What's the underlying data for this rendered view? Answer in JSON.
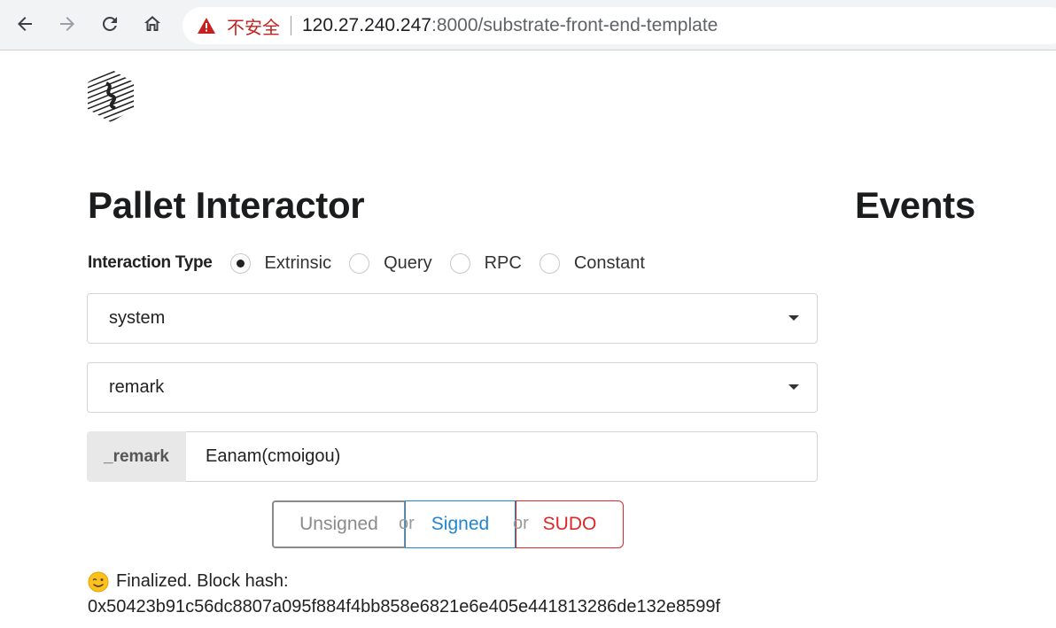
{
  "browser": {
    "security_label": "不安全",
    "url_host": "120.27.240.247",
    "url_path": ":8000/substrate-front-end-template"
  },
  "page": {
    "title": "Pallet Interactor",
    "events_title": "Events"
  },
  "interaction": {
    "label": "Interaction Type",
    "options": [
      "Extrinsic",
      "Query",
      "RPC",
      "Constant"
    ],
    "selected": "Extrinsic"
  },
  "pallet_select": {
    "value": "system"
  },
  "callable_select": {
    "value": "remark"
  },
  "param": {
    "label": "_remark",
    "value": "Eanam(cmoigou)"
  },
  "buttons": {
    "unsigned": "Unsigned",
    "or1": "or",
    "signed": "Signed",
    "or2": "or",
    "sudo": "SUDO"
  },
  "status": {
    "text": "Finalized. Block hash:",
    "hash": "0x50423b91c56dc8807a095f884f4bb858e6821e6e405e441813286de132e8599f"
  },
  "icons": {
    "back": "arrow-left-icon",
    "forward": "arrow-right-icon",
    "reload": "reload-icon",
    "home": "home-icon",
    "warning": "warning-triangle-icon",
    "logo": "substrate-logo",
    "status_emoji": "wink-emoji-icon"
  },
  "colors": {
    "signed": "#2185d0",
    "sudo": "#db2828",
    "unsigned": "#8a8a8a",
    "warning": "#c5221f"
  }
}
